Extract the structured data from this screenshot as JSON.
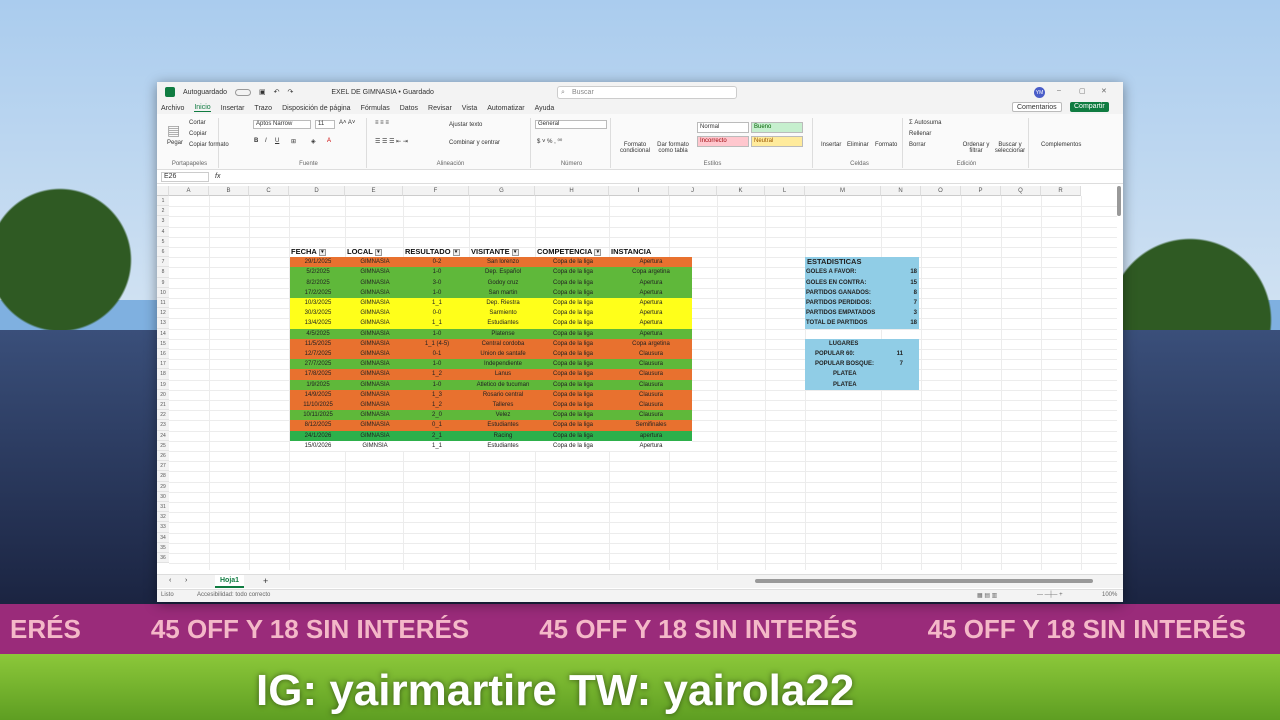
{
  "background": {
    "banner_text": [
      "ERÉS",
      "45 OFF Y 18 SIN INTERÉS",
      "45 OFF Y 18 SIN INTERÉS",
      "45 OFF Y 18 SIN INTERÉS"
    ],
    "watermark": "IG: yairmartire TW: yairola22"
  },
  "window": {
    "autosave_label": "Autoguardado",
    "file_title": "EXEL DE GIMNASIA • Guardado",
    "search_placeholder": "Buscar",
    "avatar_initials": "YM",
    "menu": [
      "Archivo",
      "Inicio",
      "Insertar",
      "Trazo",
      "Disposición de página",
      "Fórmulas",
      "Datos",
      "Revisar",
      "Vista",
      "Automatizar",
      "Ayuda"
    ],
    "comments_label": "Comentarios",
    "share_label": "Compartir"
  },
  "ribbon": {
    "paste_label": "Pegar",
    "cut_label": "Cortar",
    "copy_label": "Copiar",
    "format_painter_label": "Copiar formato",
    "clipboard_group": "Portapapeles",
    "font_name": "Aptos Narrow",
    "font_size": "11",
    "font_group": "Fuente",
    "wrap_label": "Ajustar texto",
    "merge_label": "Combinar y centrar",
    "alignment_group": "Alineación",
    "number_format": "General",
    "number_group": "Número",
    "conditional_label": "Formato condicional",
    "table_format_label": "Dar formato como tabla",
    "style_normal": "Normal",
    "style_good": "Bueno",
    "style_bad": "Incorrecto",
    "style_neutral": "Neutral",
    "styles_group": "Estilos",
    "insert_label": "Insertar",
    "delete_label": "Eliminar",
    "format_label": "Formato",
    "cells_group": "Celdas",
    "autosum_label": "Autosuma",
    "fill_label": "Rellenar",
    "clear_label": "Borrar",
    "sort_label": "Ordenar y filtrar",
    "find_label": "Buscar y seleccionar",
    "editing_group": "Edición",
    "addins_label": "Complementos"
  },
  "formula_bar": {
    "name_box": "E26",
    "fx": "fx"
  },
  "columns": [
    "A",
    "B",
    "C",
    "D",
    "E",
    "F",
    "G",
    "H",
    "I",
    "J",
    "K",
    "L",
    "M",
    "N",
    "O",
    "P",
    "Q",
    "R"
  ],
  "rows": [
    "1",
    "2",
    "3",
    "4",
    "5",
    "6",
    "7",
    "8",
    "9",
    "10",
    "11",
    "12",
    "13",
    "14",
    "15",
    "16",
    "17",
    "18",
    "19",
    "20",
    "21",
    "22",
    "23",
    "24",
    "25",
    "26",
    "27",
    "28",
    "29",
    "30",
    "31",
    "32",
    "33",
    "34",
    "35",
    "36"
  ],
  "table": {
    "headers": [
      "FECHA",
      "LOCAL",
      "RESULTADO",
      "VISITANTE",
      "COMPETENCIA",
      "INSTANCIA"
    ],
    "rows": [
      {
        "fecha": "29/1/2025",
        "local": "GIMNASIA",
        "resultado": "0-2",
        "visitante": "San lorenzo",
        "competencia": "Copa de la liga",
        "instancia": "Apertura",
        "color": "#e8712f"
      },
      {
        "fecha": "5/2/2025",
        "local": "GIMNASIA",
        "resultado": "1-0",
        "visitante": "Dep. Español",
        "competencia": "Copa de la liga",
        "instancia": "Copa argetina",
        "color": "#5fb83a"
      },
      {
        "fecha": "8/2/2025",
        "local": "GIMNASIA",
        "resultado": "3-0",
        "visitante": "Godoy cruz",
        "competencia": "Copa de la liga",
        "instancia": "Apertura",
        "color": "#5fb83a"
      },
      {
        "fecha": "17/2/2025",
        "local": "GIMNASIA",
        "resultado": "1-0",
        "visitante": "San martin",
        "competencia": "Copa de la liga",
        "instancia": "Apertura",
        "color": "#5fb83a"
      },
      {
        "fecha": "10/3/2025",
        "local": "GIMNASIA",
        "resultado": "1_1",
        "visitante": "Dep. Riestra",
        "competencia": "Copa de la liga",
        "instancia": "Apertura",
        "color": "#ffff1a"
      },
      {
        "fecha": "30/3/2025",
        "local": "GIMNASIA",
        "resultado": "0-0",
        "visitante": "Sarmiento",
        "competencia": "Copa de la liga",
        "instancia": "Apertura",
        "color": "#ffff1a"
      },
      {
        "fecha": "13/4/2025",
        "local": "GIMNASIA",
        "resultado": "1_1",
        "visitante": "Estudiantes",
        "competencia": "Copa de la liga",
        "instancia": "Apertura",
        "color": "#ffff1a"
      },
      {
        "fecha": "4/5/2025",
        "local": "GIMNASIA",
        "resultado": "1-0",
        "visitante": "Platense",
        "competencia": "Copa de la liga",
        "instancia": "Apertura",
        "color": "#5fb83a"
      },
      {
        "fecha": "11/5/2025",
        "local": "GIMNASIA",
        "resultado": "1_1 (4-5)",
        "visitante": "Central cordoba",
        "competencia": "Copa de la liga",
        "instancia": "Copa argetina",
        "color": "#e8712f"
      },
      {
        "fecha": "12/7/2025",
        "local": "GIMNASIA",
        "resultado": "0-1",
        "visitante": "Union de santafe",
        "competencia": "Copa de la liga",
        "instancia": "Clausura",
        "color": "#e8712f"
      },
      {
        "fecha": "27/7/2025",
        "local": "GIMNASIA",
        "resultado": "1-0",
        "visitante": "Independiente",
        "competencia": "Copa de la liga",
        "instancia": "Clausura",
        "color": "#5fb83a"
      },
      {
        "fecha": "17/8/2025",
        "local": "GIMNASIA",
        "resultado": "1_2",
        "visitante": "Lanus",
        "competencia": "Copa de la liga",
        "instancia": "Clausura",
        "color": "#e8712f"
      },
      {
        "fecha": "1/9/2025",
        "local": "GIMNASIA",
        "resultado": "1-0",
        "visitante": "Atletico de tucuman",
        "competencia": "Copa de la liga",
        "instancia": "Clausura",
        "color": "#5fb83a"
      },
      {
        "fecha": "14/9/2025",
        "local": "GIMNASIA",
        "resultado": "1_3",
        "visitante": "Rosario central",
        "competencia": "Copa de la liga",
        "instancia": "Clausura",
        "color": "#e8712f"
      },
      {
        "fecha": "11/10/2025",
        "local": "GIMNASIA",
        "resultado": "1_2",
        "visitante": "Talleres",
        "competencia": "Copa de la liga",
        "instancia": "Clausura",
        "color": "#e8712f"
      },
      {
        "fecha": "10/11/2025",
        "local": "GIMNASIA",
        "resultado": "2_0",
        "visitante": "Velez",
        "competencia": "Copa de la liga",
        "instancia": "Clausura",
        "color": "#5fb83a"
      },
      {
        "fecha": "8/12/2025",
        "local": "GIMNASIA",
        "resultado": "0_1",
        "visitante": "Estudiantes",
        "competencia": "Copa de la liga",
        "instancia": "Semifinales",
        "color": "#e8712f"
      },
      {
        "fecha": "24/1/2026",
        "local": "GIMNASIA",
        "resultado": "2_1",
        "visitante": "Racing",
        "competencia": "Copa de la liga",
        "instancia": "apertura",
        "color": "#2db04b"
      },
      {
        "fecha": "15/0/2026",
        "local": "GIMNSIA",
        "resultado": "1_1",
        "visitante": "Estudiantes",
        "competencia": "Copa de la liga",
        "instancia": "Apertura",
        "color": "#ffffff"
      }
    ]
  },
  "stats": {
    "title": "ESTADISTICAS",
    "rows": [
      {
        "label": "GOLES A FAVOR:",
        "value": "18"
      },
      {
        "label": "GOLES EN CONTRA:",
        "value": "15"
      },
      {
        "label": "PARTIDOS GANADOS:",
        "value": "8"
      },
      {
        "label": "PARTIDOS PERDIDOS:",
        "value": "7"
      },
      {
        "label": "PARTIDOS EMPATADOS",
        "value": "3"
      },
      {
        "label": "TOTAL DE PARTIDOS",
        "value": "18"
      }
    ],
    "places_title": "LUGARES",
    "places": [
      {
        "label": "POPULAR 60:",
        "value": "11"
      },
      {
        "label": "POPULAR BOSQUE:",
        "value": "7"
      },
      {
        "label": "PLATEA",
        "value": ""
      },
      {
        "label": "PLATEA",
        "value": ""
      }
    ]
  },
  "sheets": {
    "active": "Hoja1",
    "add": "+"
  },
  "status": {
    "mode": "Listo",
    "accessibility": "Accesibilidad: todo correcto",
    "zoom": "100%"
  }
}
